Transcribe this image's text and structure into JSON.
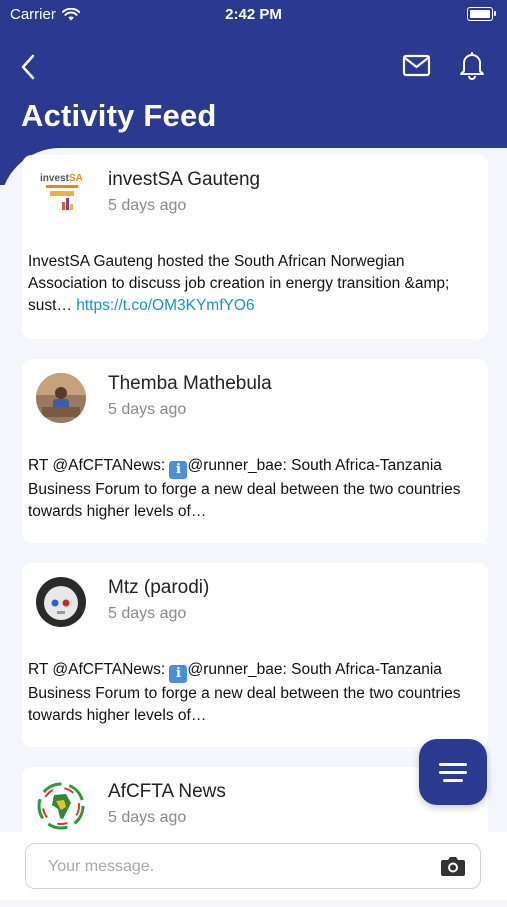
{
  "status": {
    "carrier": "Carrier",
    "time": "2:42 PM"
  },
  "header": {
    "title": "Activity Feed",
    "icons": [
      "back-icon",
      "mail-icon",
      "bell-icon"
    ]
  },
  "feed": [
    {
      "name": "investSA Gauteng",
      "time": "5 days ago",
      "text": "InvestSA Gauteng hosted the South African Norwegian Association to discuss job creation in energy transition &amp; sust… ",
      "link": "https://t.co/OM3KYmfYO6"
    },
    {
      "name": "Themba Mathebula",
      "time": "5 days ago",
      "text_before": "RT @AfCFTANews: ",
      "text_after": "@runner_bae: South Africa-Tanzania Business Forum to forge a new deal between the two countries towards higher levels of…"
    },
    {
      "name": "Mtz (parodi)",
      "time": "5 days ago",
      "text_before": "RT @AfCFTANews: ",
      "text_after": "@runner_bae: South Africa-Tanzania Business Forum to forge a new deal between the two countries towards higher levels of…"
    },
    {
      "name": "AfCFTA News",
      "time": "5 days ago"
    }
  ],
  "message": {
    "placeholder": "Your message."
  },
  "colors": {
    "brand": "#2b3990",
    "link": "#1a8fd8",
    "background": "#f4f6fc"
  }
}
